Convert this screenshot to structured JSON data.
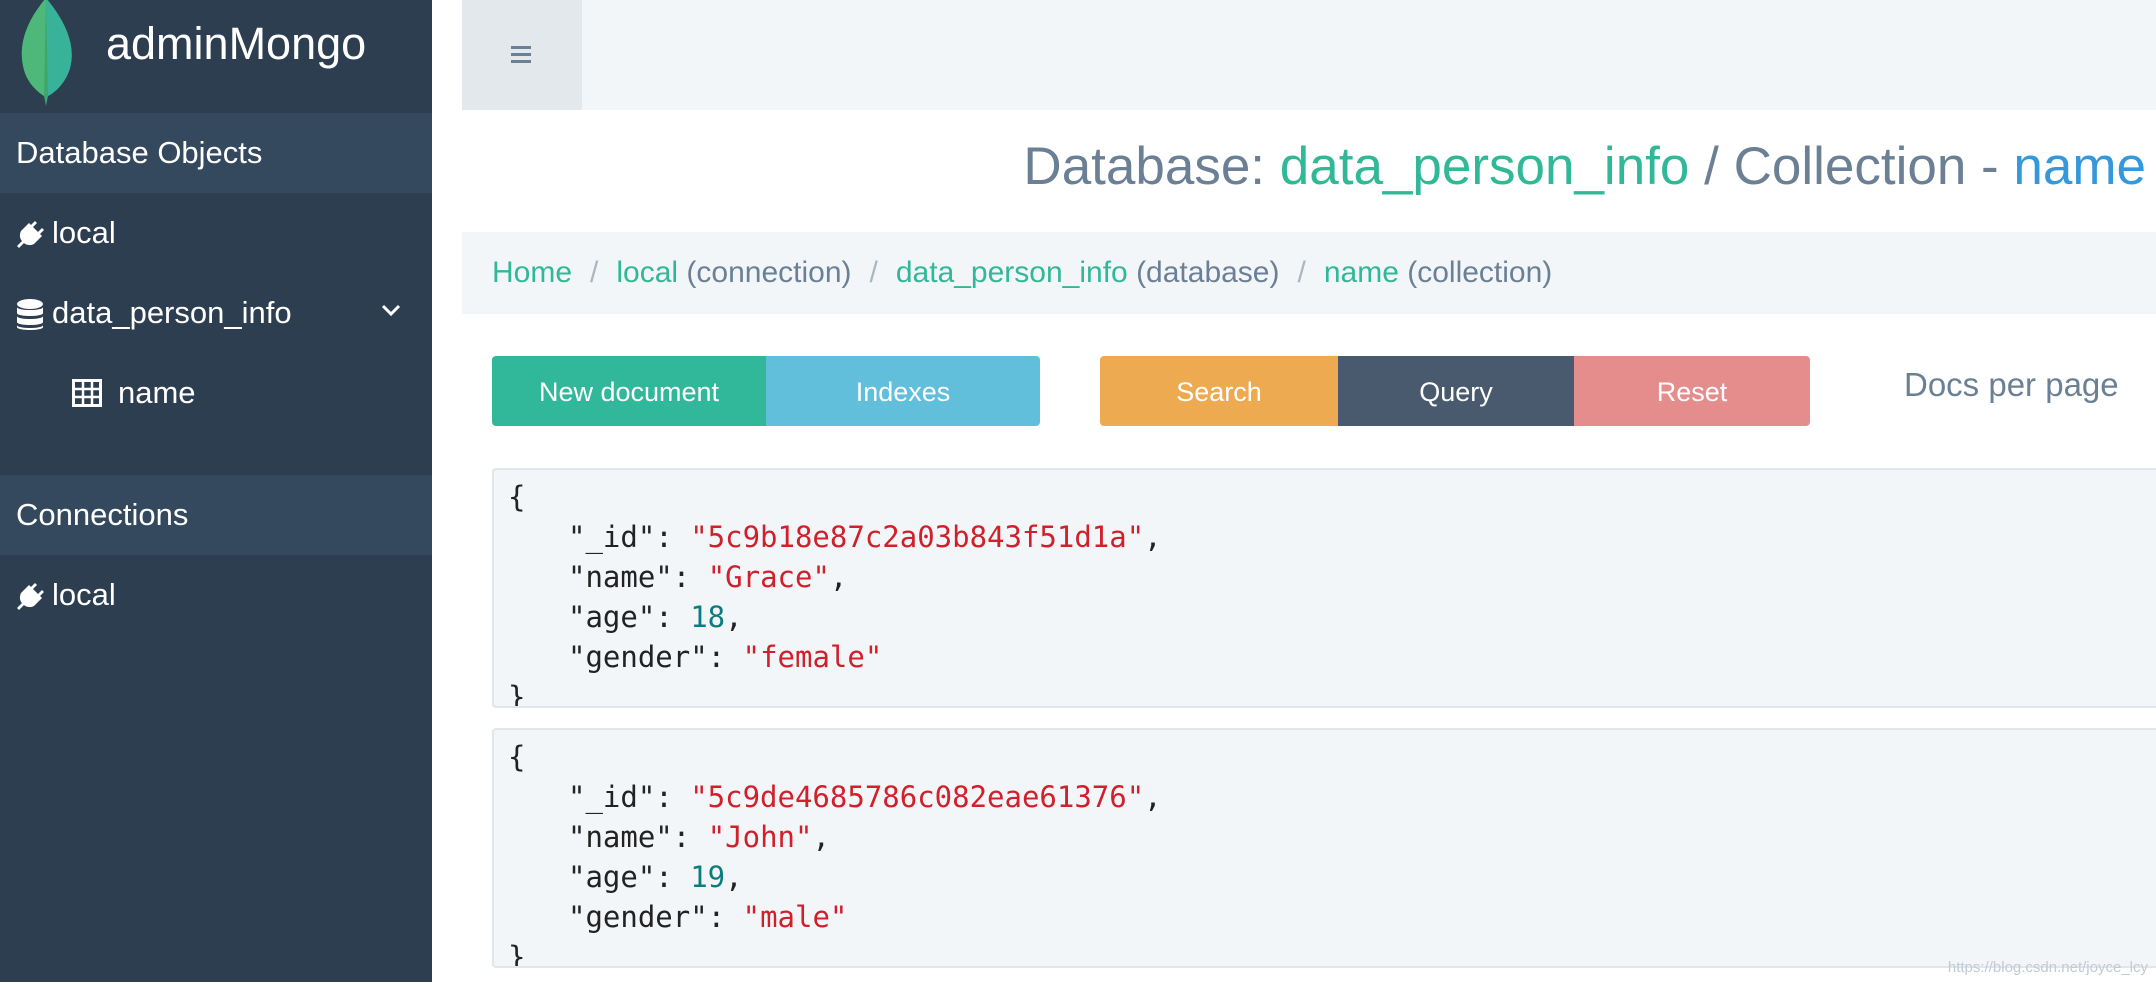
{
  "app": {
    "brand": "adminMongo"
  },
  "sidebar": {
    "section_db_objects": "Database Objects",
    "db_items": [
      {
        "label": "local",
        "icon": "plug-icon"
      },
      {
        "label": "data_person_info",
        "icon": "database-icon"
      }
    ],
    "collection_item": {
      "label": "name",
      "icon": "table-icon"
    },
    "section_connections": "Connections",
    "connections": [
      {
        "label": "local",
        "icon": "plug-icon"
      }
    ]
  },
  "header": {
    "title_prefix": "Database:",
    "title_db": "data_person_info",
    "title_sep": "/ Collection -",
    "title_collection": "name"
  },
  "breadcrumb": {
    "home": "Home",
    "sep": "/",
    "connection": "local",
    "connection_suffix": "(connection)",
    "database": "data_person_info",
    "database_suffix": "(database)",
    "collection": "name",
    "collection_suffix": "(collection)"
  },
  "toolbar": {
    "new_document": "New document",
    "indexes": "Indexes",
    "search": "Search",
    "query": "Query",
    "reset": "Reset",
    "docs_per_page": "Docs per page"
  },
  "documents": [
    {
      "_id": "\"5c9b18e87c2a03b843f51d1a\"",
      "name": "\"Grace\"",
      "age": "18",
      "gender": "\"female\""
    },
    {
      "_id": "\"5c9de4685786c082eae61376\"",
      "name": "\"John\"",
      "age": "19",
      "gender": "\"male\""
    }
  ],
  "json_keys": {
    "id": "\"_id\": ",
    "name": "\"name\": ",
    "age": "\"age\": ",
    "gender": "\"gender\": "
  },
  "json_punct": {
    "open": "{",
    "close": "}",
    "comma": ","
  },
  "watermark": "https://blog.csdn.net/joyce_lcy",
  "colors": {
    "sidebar": "#2c3e50",
    "accent_green": "#30b897",
    "accent_blue": "#3498db"
  }
}
